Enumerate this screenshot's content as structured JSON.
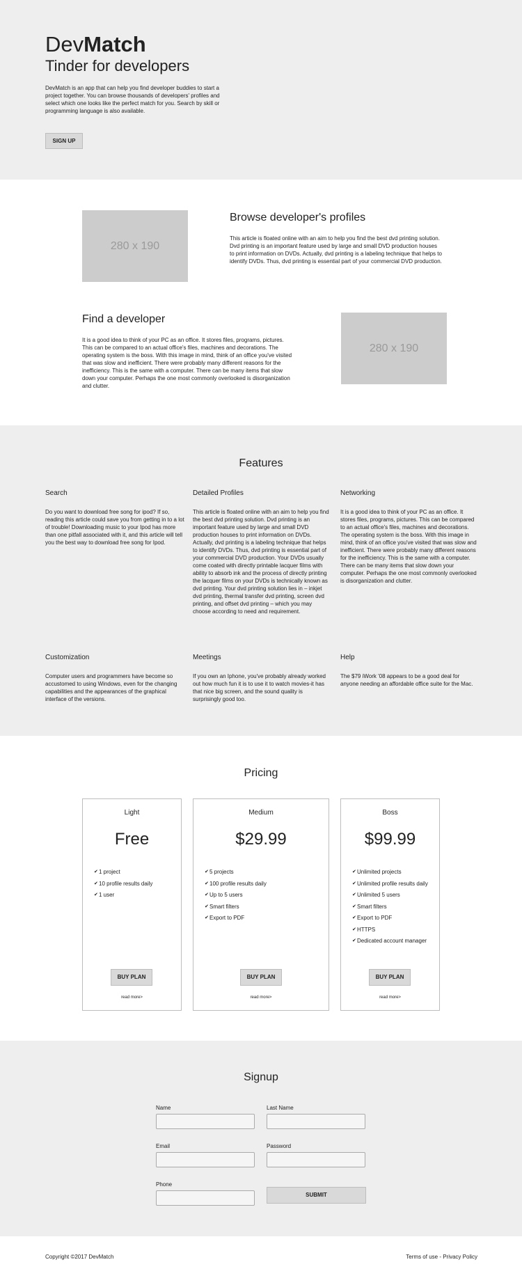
{
  "hero": {
    "brand_prefix": "Dev",
    "brand_bold": "Match",
    "tagline": "Tinder for developers",
    "description": "DevMatch is an app that can help you find developer buddies to start a project together. You can browse thousands of developers' profiles and select which one looks like the perfect match for you. Search by skill or programming language is also available.",
    "cta_label": "SIGN UP"
  },
  "profiles": [
    {
      "image_label": "280 x 190",
      "title": "Browse developer's profiles",
      "text": "This article is floated online with an aim to help you find the best dvd printing solution. Dvd printing is an important feature used by large and small DVD production houses to print information on DVDs. Actually, dvd printing is a labeling technique that helps to identify DVDs. Thus, dvd printing is essential part of your commercial DVD production."
    },
    {
      "image_label": "280 x 190",
      "title": "Find a developer",
      "text": "It is a good idea to think of your PC as an office. It stores files, programs, pictures. This can be compared to an actual office's files, machines and decorations. The operating system is the boss. With this image in mind, think of an office you've visited that was slow and inefficient. There were probably many different reasons for the inefficiency. This is the same with a computer. There can be many items that slow down your computer. Perhaps the one most commonly overlooked is disorganization and clutter."
    }
  ],
  "features": {
    "title": "Features",
    "items": [
      {
        "title": "Search",
        "text": "Do you want to download free song for ipod? If so, reading this article could save you from getting in to a lot of trouble! Downloading music to your Ipod has more than one pitfall associated with it, and this article will tell you the best way to download free song for Ipod."
      },
      {
        "title": "Detailed Profiles",
        "text": "This article is floated online with an aim to help you find the best dvd printing solution. Dvd printing is an important feature used by large and small DVD production houses to print information on DVDs. Actually, dvd printing is a labeling technique that helps to identify DVDs. Thus, dvd printing is essential part of your commercial DVD production. Your DVDs usually come coated with directly printable lacquer films with ability to absorb ink and the process of directly printing the lacquer films on your DVDs is technically known as dvd printing. Your dvd printing solution lies in – inkjet dvd printing, thermal transfer dvd printing, screen dvd printing, and offset dvd printing – which you may choose according to need and requirement."
      },
      {
        "title": "Networking",
        "text": "It is a good idea to think of your PC as an office. It stores files, programs, pictures. This can be compared to an actual office's files, machines and decorations. The operating system is the boss. With this image in mind, think of an office you've visited that was slow and inefficient. There were probably many different reasons for the inefficiency. This is the same with a computer. There can be many items that slow down your computer. Perhaps the one most commonly overlooked is disorganization and clutter."
      },
      {
        "title": "Customization",
        "text": "Computer users and programmers have become so accustomed to using Windows, even for the changing capabilities and the appearances of the graphical interface of the versions."
      },
      {
        "title": "Meetings",
        "text": "If you own an Iphone, you've probably already worked out how much fun it is to use it to watch movies-it has that nice big screen, and the sound quality is surprisingly good too."
      },
      {
        "title": "Help",
        "text": "The $79 iWork '08 appears to be a good deal for anyone needing an affordable office suite for the Mac."
      }
    ]
  },
  "pricing": {
    "title": "Pricing",
    "plans": [
      {
        "name": "Light",
        "price": "Free",
        "features": [
          "1 project",
          "10 profile results daily",
          "1 user"
        ],
        "button": "BUY PLAN",
        "more": "read more>"
      },
      {
        "name": "Medium",
        "price": "$29.99",
        "features": [
          "5 projects",
          "100 profile results daily",
          "Up to 5 users",
          "Smart filters",
          "Export to PDF"
        ],
        "button": "BUY PLAN",
        "more": "read more>"
      },
      {
        "name": "Boss",
        "price": "$99.99",
        "features": [
          "Unlimited projects",
          "Unlimited profile results daily",
          "Unlimited 5 users",
          "Smart filters",
          "Export to PDF",
          "HTTPS",
          "Dedicated account manager"
        ],
        "button": "BUY PLAN",
        "more": "read more>"
      }
    ]
  },
  "signup": {
    "title": "Signup",
    "name_label": "Name",
    "last_name_label": "Last Name",
    "email_label": "Email",
    "password_label": "Password",
    "phone_label": "Phone",
    "submit_label": "SUBMIT"
  },
  "footer": {
    "copyright": "Copyright ©2017 DevMatch",
    "terms": "Terms of use",
    "separator": " - ",
    "privacy": "Privacy Policy"
  }
}
